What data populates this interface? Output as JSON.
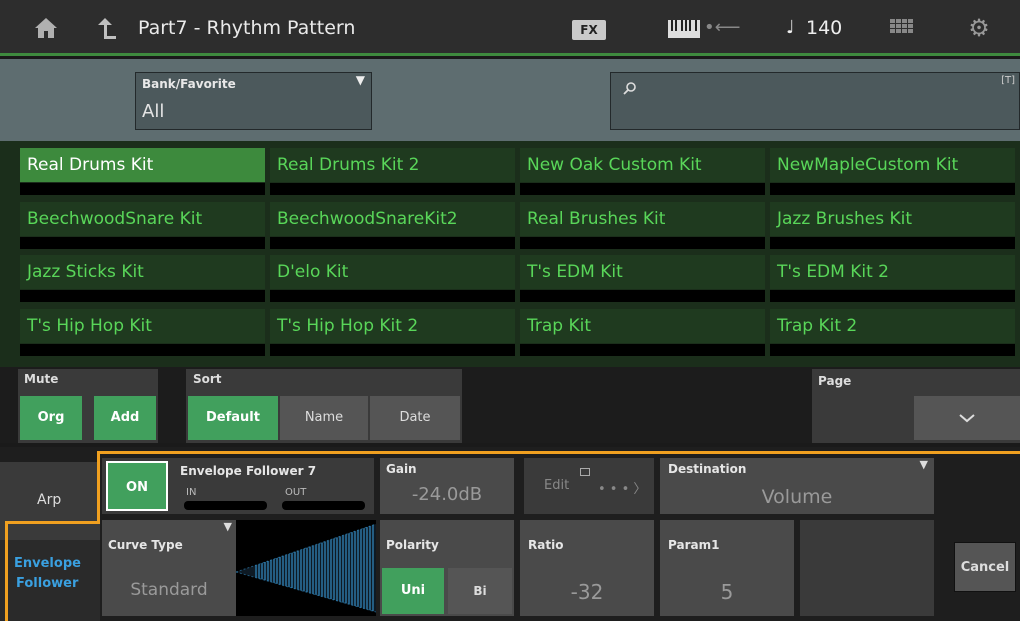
{
  "header": {
    "title": "Part7 - Rhythm Pattern",
    "fx_label": "FX",
    "tempo_symbol": "♩",
    "tempo": "140"
  },
  "filter": {
    "bank_label": "Bank/Favorite",
    "bank_value": "All",
    "search_icon_glyph": "⌕",
    "text_icon_glyph": "[T]"
  },
  "kits": [
    "Real Drums Kit",
    "Real Drums Kit 2",
    "New Oak Custom Kit",
    "NewMapleCustom Kit",
    "BeechwoodSnare Kit",
    "BeechwoodSnareKit2",
    "Real Brushes Kit",
    "Jazz Brushes Kit",
    "Jazz Sticks Kit",
    "D'elo Kit",
    "T's EDM Kit",
    "T's EDM Kit 2",
    "T's Hip Hop Kit",
    "T's Hip Hop Kit 2",
    "Trap Kit",
    "Trap Kit 2"
  ],
  "selected_kit": "Real Drums Kit",
  "mute": {
    "label": "Mute",
    "org": "Org",
    "add": "Add"
  },
  "sort": {
    "label": "Sort",
    "default": "Default",
    "name": "Name",
    "date": "Date"
  },
  "page": {
    "label": "Page",
    "down_glyph": "﹀"
  },
  "side_tabs": {
    "arp": "Arp",
    "envelope_follower_1": "Envelope",
    "envelope_follower_2": "Follower"
  },
  "envelope": {
    "on": "ON",
    "title": "Envelope Follower 7",
    "in": "IN",
    "out": "OUT",
    "gain_label": "Gain",
    "gain_value": "-24.0dB",
    "edit": "Edit",
    "dots": "• • • 〉",
    "destination_label": "Destination",
    "destination_value": "Volume",
    "curve_label": "Curve Type",
    "curve_value": "Standard",
    "polarity_label": "Polarity",
    "uni": "Uni",
    "bi": "Bi",
    "ratio_label": "Ratio",
    "ratio_value": "-32",
    "param1_label": "Param1",
    "param1_value": "5",
    "cancel": "Cancel"
  },
  "colors": {
    "accent_green": "#41a05d",
    "kit_text": "#59d659",
    "highlight_orange": "#f0a020",
    "envelope_blue": "#3aa0e0"
  }
}
